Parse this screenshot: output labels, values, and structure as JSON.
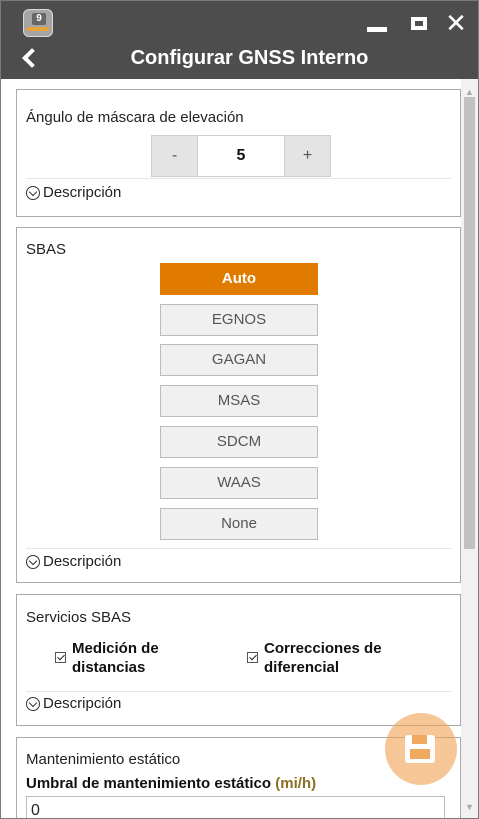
{
  "window": {
    "app_badge": "9",
    "title": "Configurar GNSS Interno",
    "close_glyph": "✕",
    "icons": [
      "back-icon",
      "minimize-icon",
      "maximize-icon",
      "close-icon",
      "save-icon"
    ]
  },
  "elevation_mask": {
    "label": "Ángulo de máscara de elevación",
    "minus": "-",
    "value": "5",
    "plus": "+",
    "description": "Descripción"
  },
  "sbas": {
    "label": "SBAS",
    "options": [
      "Auto",
      "EGNOS",
      "GAGAN",
      "MSAS",
      "SDCM",
      "WAAS",
      "None"
    ],
    "selected": "Auto",
    "description": "Descripción"
  },
  "sbas_services": {
    "label": "Servicios SBAS",
    "ranging": "Medición de distancias",
    "ranging_checked": true,
    "differential": "Correcciones de diferencial",
    "differential_checked": true,
    "description": "Descripción"
  },
  "static_hold": {
    "label": "Mantenimiento estático",
    "threshold_label": "Umbral de mantenimiento estático",
    "threshold_unit": "(mi/h)",
    "threshold_value": "0"
  },
  "colors": {
    "accent": "#e07b00",
    "titlebar": "#4d4d4d"
  }
}
